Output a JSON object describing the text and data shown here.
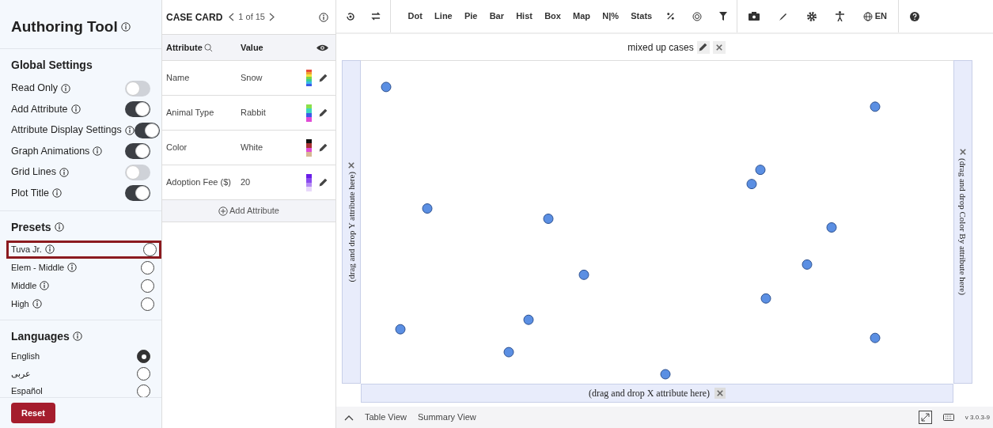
{
  "sidebar": {
    "title": "Authoring Tool",
    "global_settings": {
      "heading": "Global Settings",
      "items": [
        {
          "label": "Read Only",
          "on": false
        },
        {
          "label": "Add Attribute",
          "on": true
        },
        {
          "label": "Attribute Display Settings",
          "on": true
        },
        {
          "label": "Graph Animations",
          "on": true
        },
        {
          "label": "Grid Lines",
          "on": false
        },
        {
          "label": "Plot Title",
          "on": true
        }
      ]
    },
    "presets": {
      "heading": "Presets",
      "items": [
        {
          "label": "Tuva Jr.",
          "selected": false,
          "highlighted": true
        },
        {
          "label": "Elem - Middle",
          "selected": false,
          "highlighted": false
        },
        {
          "label": "Middle",
          "selected": false,
          "highlighted": false
        },
        {
          "label": "High",
          "selected": false,
          "highlighted": false
        }
      ]
    },
    "languages": {
      "heading": "Languages",
      "items": [
        {
          "label": "English",
          "selected": true
        },
        {
          "label": "عربى",
          "selected": false
        },
        {
          "label": "Español",
          "selected": false
        }
      ]
    },
    "reset_button": "Reset"
  },
  "case_card": {
    "title": "CASE CARD",
    "counter": "1 of 15",
    "columns": [
      "Attribute",
      "Value"
    ],
    "rows": [
      {
        "attribute": "Name",
        "value": "Snow"
      },
      {
        "attribute": "Animal Type",
        "value": "Rabbit"
      },
      {
        "attribute": "Color",
        "value": "White"
      },
      {
        "attribute": "Adoption Fee ($)",
        "value": "20"
      }
    ],
    "add_attribute": "Add Attribute"
  },
  "toolbar": {
    "plot_types": [
      "Dot",
      "Line",
      "Pie",
      "Bar",
      "Hist",
      "Box",
      "Map",
      "N|%",
      "Stats"
    ],
    "language": "EN"
  },
  "graph": {
    "title": "mixed up cases",
    "y_drop": "(drag and drop Y attribute here)",
    "x_drop": "(drag and drop X attribute here)",
    "color_drop": "(drag and drop Color By attribute here)"
  },
  "bottom_bar": {
    "tabs": [
      "Table View",
      "Summary View"
    ],
    "version": "v 3.0.3-9"
  }
}
